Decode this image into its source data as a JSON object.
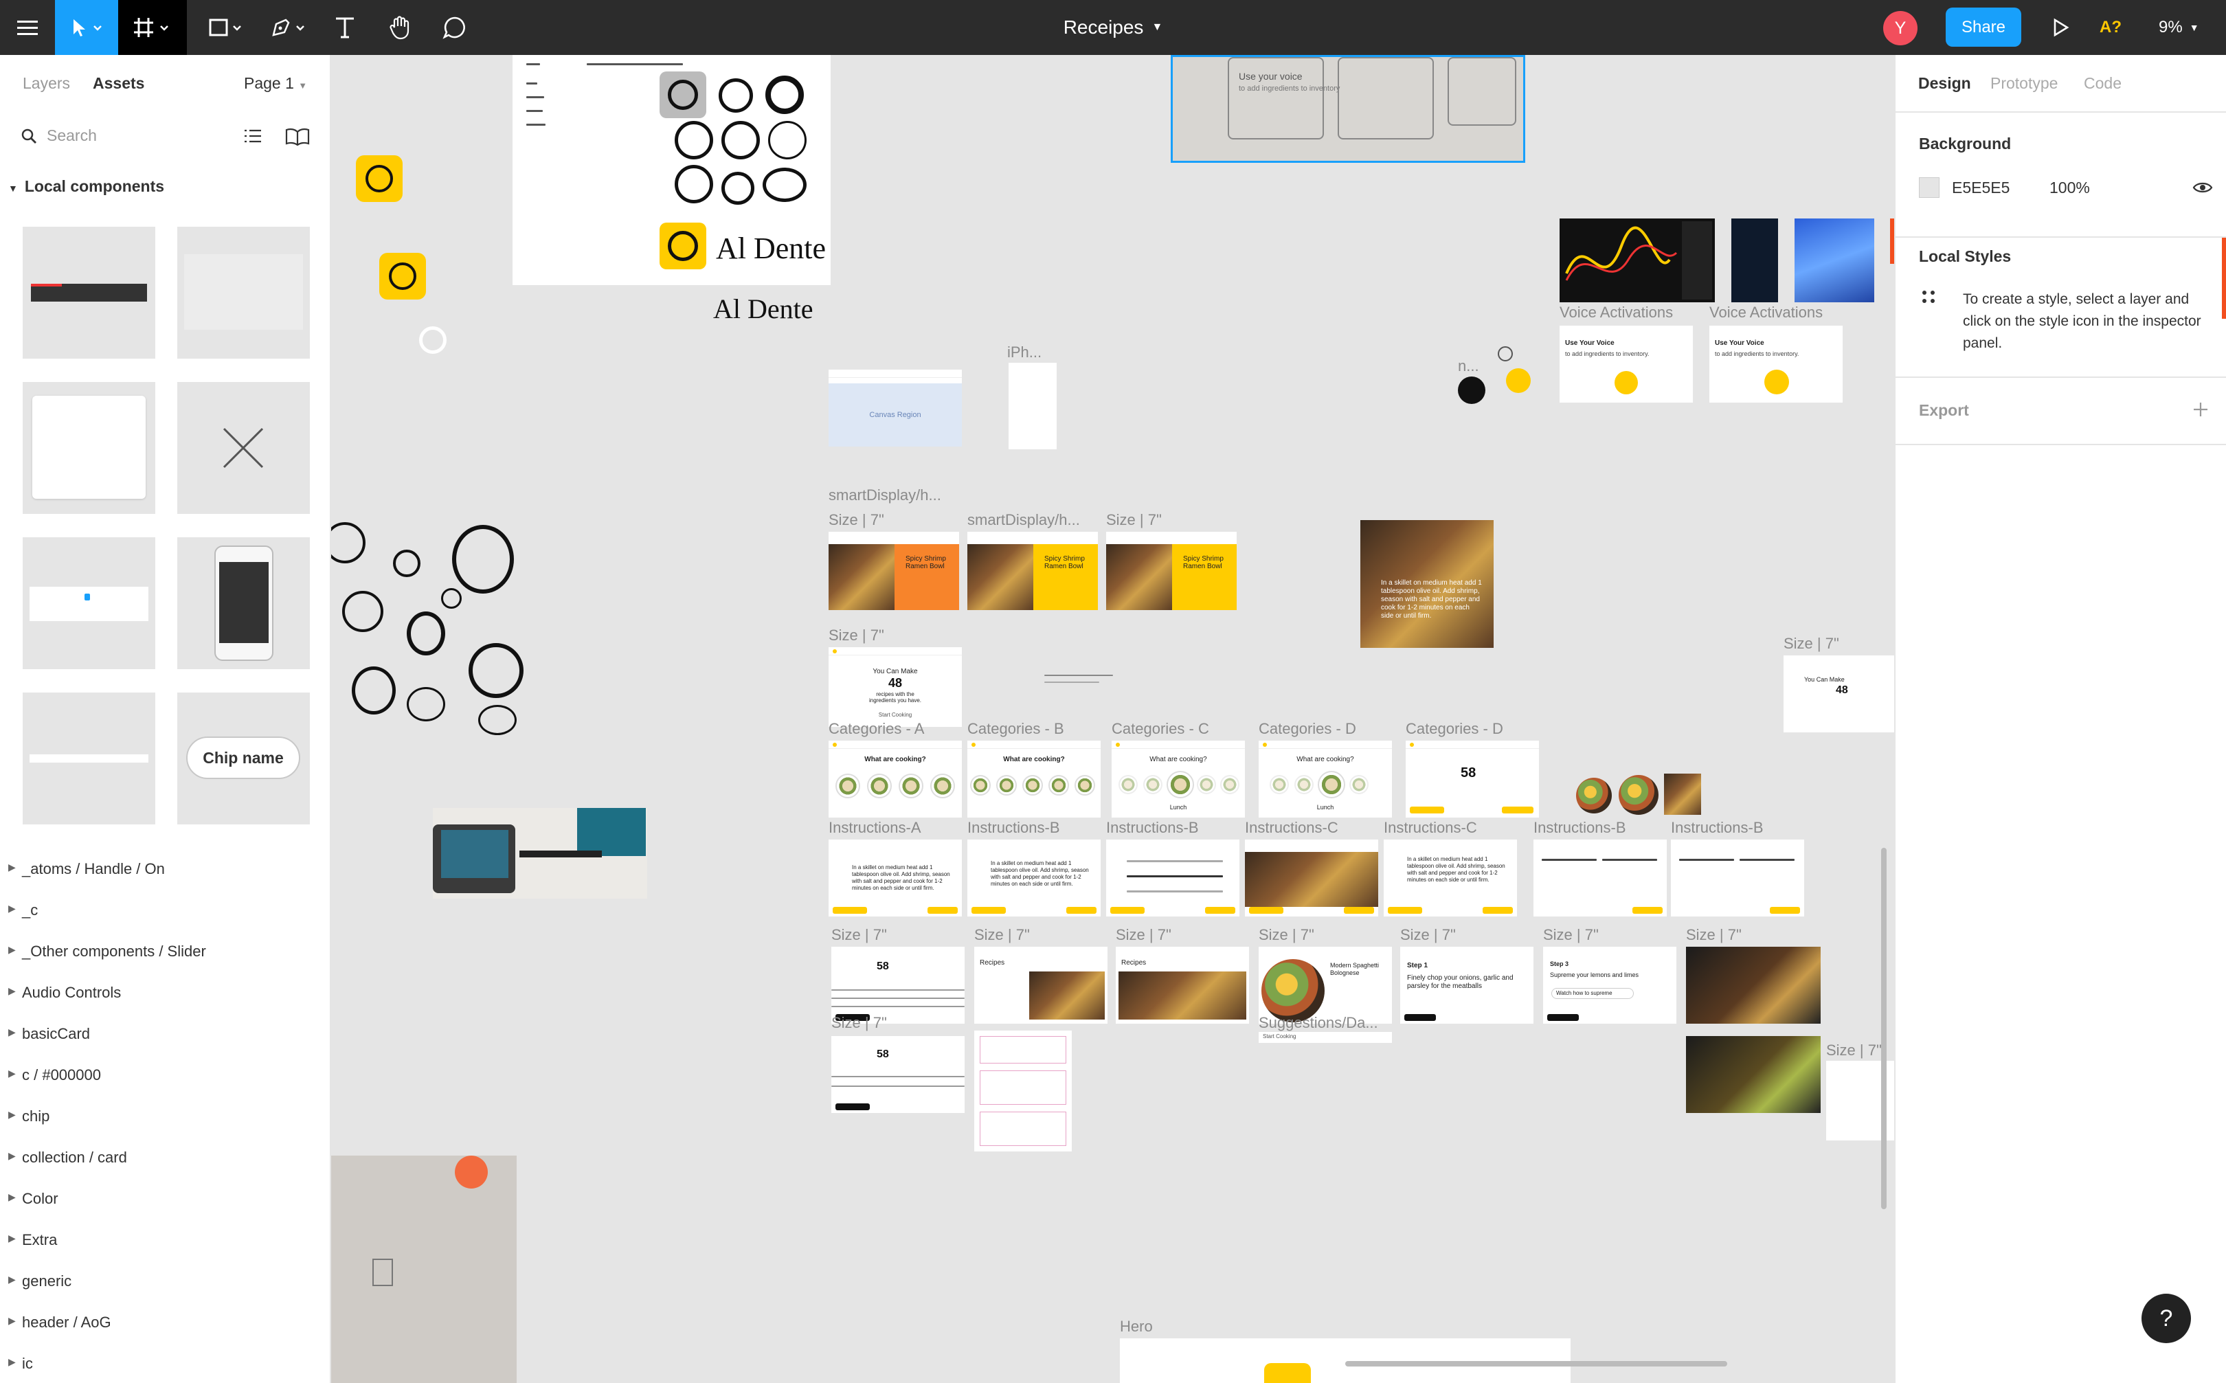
{
  "toolbar": {
    "file_title": "Receipes",
    "avatar_initial": "Y",
    "share_label": "Share",
    "a_label": "A?",
    "zoom": "9%"
  },
  "left_panel": {
    "tabs": [
      "Layers",
      "Assets"
    ],
    "page": "Page 1",
    "search_placeholder": "Search",
    "section_title": "Local components",
    "chip_name": "Chip name",
    "tree_items": [
      "_atoms / Handle / On",
      "_c",
      "_Other components / Slider",
      "Audio Controls",
      "basicCard",
      "c / #000000",
      "chip",
      "collection / card",
      "Color",
      "Extra",
      "generic",
      "header / AoG",
      "ic"
    ]
  },
  "right_panel": {
    "tabs": [
      "Design",
      "Prototype",
      "Code"
    ],
    "background_title": "Background",
    "background_hex": "E5E5E5",
    "background_opacity": "100%",
    "local_styles_title": "Local Styles",
    "local_styles_hint": "To create a style, select a layer and click on the style icon in the inspector panel.",
    "export_title": "Export",
    "help": "?"
  },
  "canvas": {
    "brand": "Al Dente",
    "iphone_label": "iPh...",
    "canvas_region": "Canvas Region",
    "smartdisplay_1": "smartDisplay/h...",
    "smartdisplay_2": "smartDisplay/h...",
    "size7": "Size | 7\"",
    "voice_activations": "Voice Activations",
    "use_your_voice": "Use Your Voice",
    "to_add": "to add ingredients to inventory.",
    "mic_label": "n...",
    "you_can_make": "You Can Make",
    "count48": "48",
    "count58": "58",
    "recipes_with": "recipes with the ingredients you have.",
    "start_cooking": "Start Cooking",
    "spicy_bowl": "Spicy Shrimp Ramen Bowl",
    "what_cooking": "What are cooking?",
    "lunch": "Lunch",
    "cat_a": "Categories - A",
    "cat_b": "Categories - B",
    "cat_c": "Categories - C",
    "cat_d": "Categories - D",
    "instr_a": "Instructions-A",
    "instr_b": "Instructions-B",
    "instr_c": "Instructions-C",
    "instr_text": "In a skillet on medium heat add 1 tablespoon olive oil. Add shrimp, season with salt and pepper and cook for 1-2 minutes on each side or until firm.",
    "recipes": "Recipes",
    "modern_spaghetti": "Modern Spaghetti Bolognese",
    "step1": "Step 1",
    "step1_text": "Finely chop your onions, garlic and parsley for the meatballs",
    "step3": "Step 3",
    "step3_text": "Supreme your lemons and limes",
    "watch": "Watch how to supreme",
    "suggestions": "Suggestions/Da...",
    "hero": "Hero",
    "sketch_text1": "Use your voice",
    "sketch_text2": "to add ingredients to inventory"
  },
  "colors": {
    "accent": "#18a0fb",
    "brand_yellow": "#ffcc00",
    "avatar": "#f24e5c",
    "canvas_bg": "#e5e5e5"
  }
}
